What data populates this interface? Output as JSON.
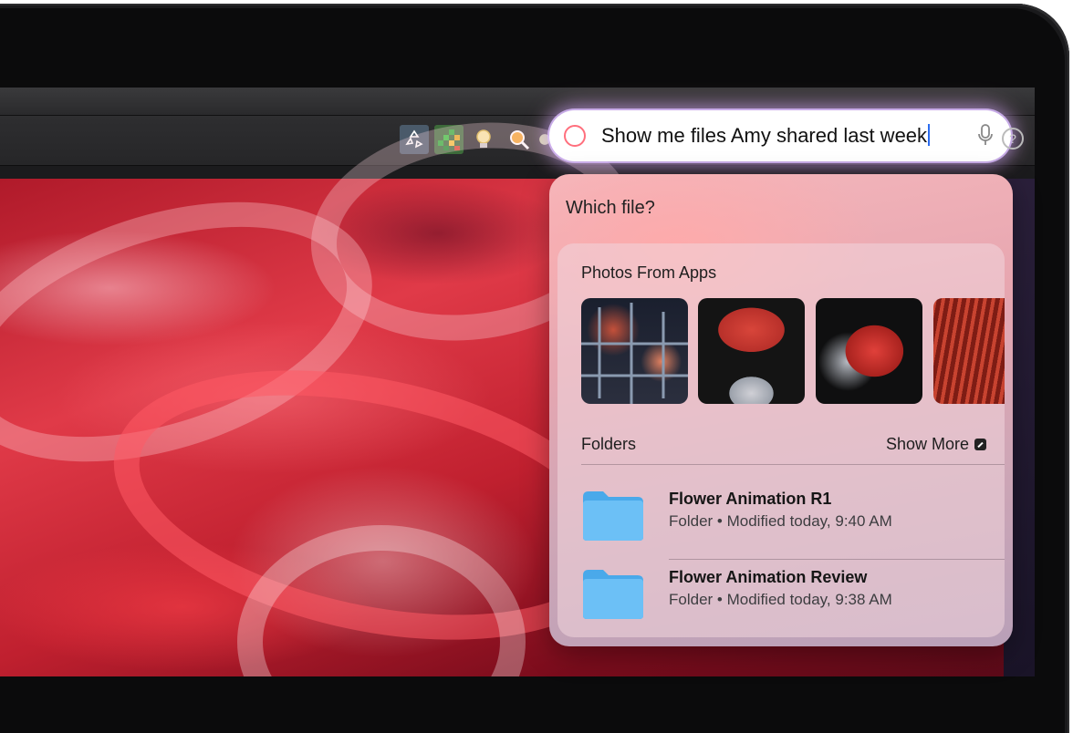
{
  "search": {
    "query": "Show me files Amy shared last week"
  },
  "panel": {
    "prompt": "Which file?",
    "photos_section": "Photos From Apps",
    "folders_section": "Folders",
    "show_more": "Show More",
    "photos": [
      {
        "icon": "photo-thumbnail"
      },
      {
        "icon": "photo-thumbnail"
      },
      {
        "icon": "photo-thumbnail"
      },
      {
        "icon": "photo-thumbnail"
      }
    ],
    "folders": [
      {
        "name": "Flower Animation R1",
        "kind": "Folder",
        "modified": "Modified today, 9:40 AM"
      },
      {
        "name": "Flower Animation Review",
        "kind": "Folder",
        "modified": "Modified today, 9:38 AM"
      }
    ],
    "separator": "•"
  },
  "menubar_icons": [
    "recycle-icon",
    "grid-app-icon",
    "lightbulb-icon",
    "magnifier-icon",
    "colorful-app-icon",
    "help-icon"
  ],
  "colors": {
    "accent_caret": "#2b6cf0",
    "folder_blue": "#5ab6f2",
    "wallpaper_red": "#c0202f"
  }
}
